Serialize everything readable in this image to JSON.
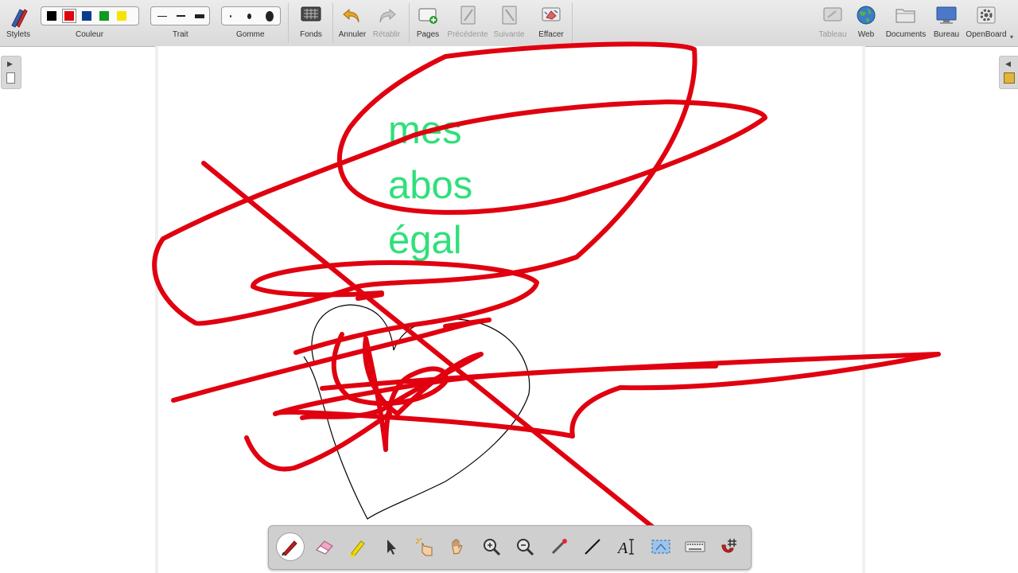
{
  "toolbar": {
    "stylets_label": "Stylets",
    "couleur_label": "Couleur",
    "trait_label": "Trait",
    "gomme_label": "Gomme",
    "fonds_label": "Fonds",
    "annuler_label": "Annuler",
    "retablir_label": "Rétablir",
    "pages_label": "Pages",
    "precedente_label": "Précédente",
    "suivante_label": "Suivante",
    "effacer_label": "Effacer",
    "tableau_label": "Tableau",
    "web_label": "Web",
    "documents_label": "Documents",
    "bureau_label": "Bureau",
    "openboard_label": "OpenBoard",
    "colors": [
      "#000000",
      "#e0000f",
      "#0a3d8f",
      "#0d9a1e",
      "#f4e400"
    ],
    "selected_color": "#e0000f"
  },
  "board": {
    "words": [
      "mes",
      "abos",
      "égal"
    ],
    "text_color": "#2fe07a",
    "stroke_color": "#e0000f"
  },
  "dock": {
    "tools": [
      "pen-icon",
      "eraser-icon",
      "highlighter-icon",
      "selector-icon",
      "interact-icon",
      "hand-icon",
      "zoom-in-icon",
      "zoom-out-icon",
      "laser-pointer-icon",
      "line-icon",
      "text-icon",
      "capture-icon",
      "keyboard-icon",
      "magnet-grid-icon"
    ],
    "active_tool": "pen-icon"
  }
}
